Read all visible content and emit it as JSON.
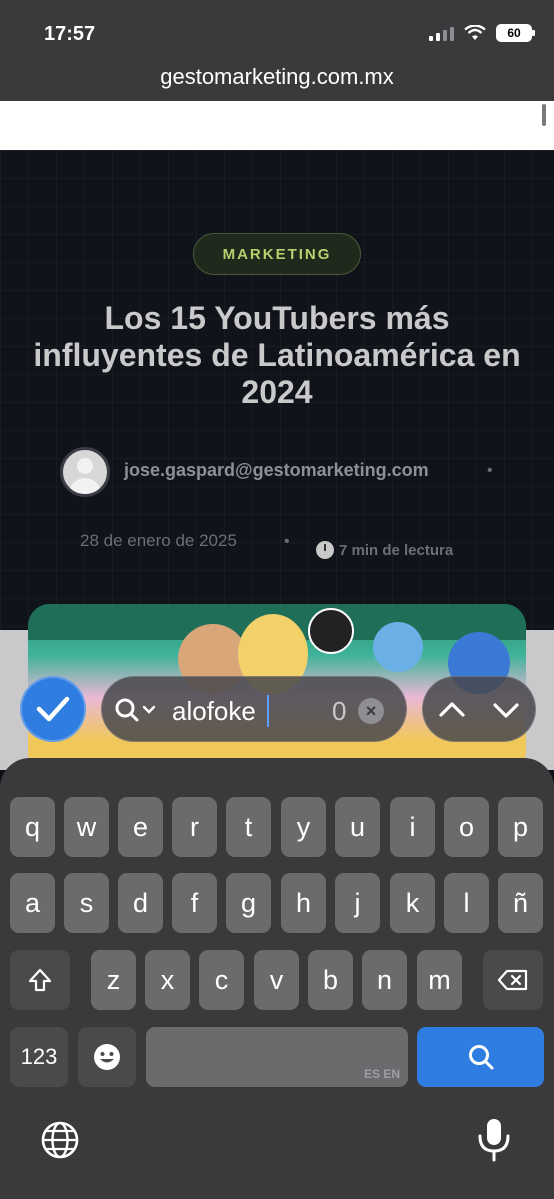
{
  "status_bar": {
    "time": "17:57",
    "battery": "60"
  },
  "browser": {
    "url": "gestomarketing.com.mx"
  },
  "article": {
    "category": "MARKETING",
    "title": "Los 15 YouTubers más influyentes de Latinoamérica en 2024",
    "author": "jose.gaspard@gestomarketing.com",
    "separator": "•",
    "date": "28 de enero de 2025",
    "read_time": "7 min de lectura"
  },
  "find_bar": {
    "query": "alofoke",
    "match_count": "0",
    "done_icon": "checkmark-icon",
    "search_icon": "magnifier-icon",
    "clear_icon": "clear-x-icon"
  },
  "keyboard": {
    "row1": [
      "q",
      "w",
      "e",
      "r",
      "t",
      "y",
      "u",
      "i",
      "o",
      "p"
    ],
    "row2": [
      "a",
      "s",
      "d",
      "f",
      "g",
      "h",
      "j",
      "k",
      "l",
      "ñ"
    ],
    "row3": [
      "z",
      "x",
      "c",
      "v",
      "b",
      "n",
      "m"
    ],
    "numbers_label": "123",
    "space_lang": "ES EN",
    "accent_color": "#2f7de0"
  }
}
